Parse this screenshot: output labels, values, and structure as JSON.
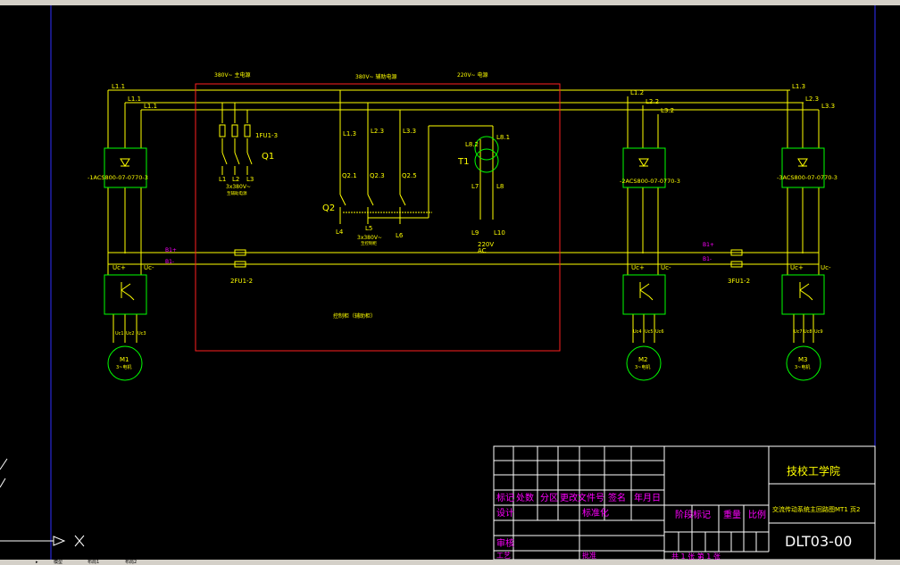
{
  "colors": {
    "background": "#000000",
    "wire": "#ffff00",
    "device": "#00ff00",
    "frame": "#ffffff",
    "cabinet": "#ff0000",
    "title_text": "#ff00ff",
    "border": "#0000ff"
  },
  "icons": [
    "model-space-tab-icon"
  ],
  "drawing": {
    "bus_labels": {
      "l11a": "L1.1",
      "l11b": "L1.1",
      "l11c": "L1.1",
      "l12": "L1.2",
      "l22": "L2.2",
      "l32": "L3.2",
      "l13": "L1.3",
      "l23": "L2.3",
      "l33": "L3.3"
    },
    "supply_labels": {
      "s1": "380V~ 主电源",
      "s2": "380V~ 辅助电源",
      "s3": "220V~ 电源"
    },
    "drives": {
      "d1": "-1ACS800-07-0770-3",
      "d2": "-2ACS800-07-0770-3",
      "d3": "-3ACS800-07-0770-3"
    },
    "fuses": {
      "fu1": "1FU1-3",
      "fu2": "2FU1-2",
      "fu3": "3FU1-2"
    },
    "q1": {
      "name": "Q1",
      "terms": [
        "L1",
        "L2",
        "L3"
      ],
      "rating": "3x380V~",
      "note": "至辅助电源"
    },
    "q2": {
      "name": "Q2",
      "ins": [
        "L1.3",
        "L2.3",
        "L3.3"
      ],
      "mids": [
        "Q2.1",
        "Q2.3",
        "Q2.5"
      ],
      "outs": [
        "L4",
        "L5",
        "L6"
      ],
      "rating": "3x380V~",
      "note": "至控制柜"
    },
    "t1": {
      "name": "T1",
      "in1": "L8.2",
      "in2": "L8.1",
      "mid1": "L7",
      "mid2": "L8",
      "out1": "L9",
      "out2": "L10",
      "volt": "220V",
      "ac": "AC"
    },
    "dc_labels": {
      "b1p": "B1+",
      "b1m": "B1-",
      "b2p": "B1+",
      "b2m": "B1-"
    },
    "uc": {
      "uc1p": "Uc+",
      "uc1m": "Uc-",
      "uc2p": "Uc+",
      "uc2m": "Uc-",
      "uc3p": "Uc+",
      "uc3m": "Uc-"
    },
    "outputs": {
      "m1": [
        "Uc1",
        "Uc2",
        "Uc3"
      ],
      "m2": [
        "Uc4",
        "Uc5",
        "Uc6"
      ],
      "m3": [
        "Uc7",
        "Uc8",
        "Uc9"
      ]
    },
    "motors": {
      "m1": "M1",
      "m2": "M2",
      "m3": "M3",
      "m1r": "3~电机",
      "m2r": "3~电机",
      "m3r": "3~电机"
    },
    "cabinet_label": "控制柜（辅助柜）"
  },
  "title_block": {
    "school": "技校工学院",
    "drawing_title": "交流传动系统主回路图MT1 页2",
    "drawing_number": "DLT03-00",
    "row_labels": [
      "标记",
      "处数",
      "分区",
      "更改文件号",
      "签名",
      "年月日"
    ],
    "design": "设计",
    "standard": "标准化",
    "stage_mark": "阶段标记",
    "weight": "重量",
    "scale": "比例",
    "review": "审核",
    "craft": "工艺",
    "approve": "批准",
    "sheet_info": "共 1 张 第 1 张"
  },
  "tabs": {
    "model": "模型",
    "layout1": "布局1",
    "layout2": "布局2"
  }
}
